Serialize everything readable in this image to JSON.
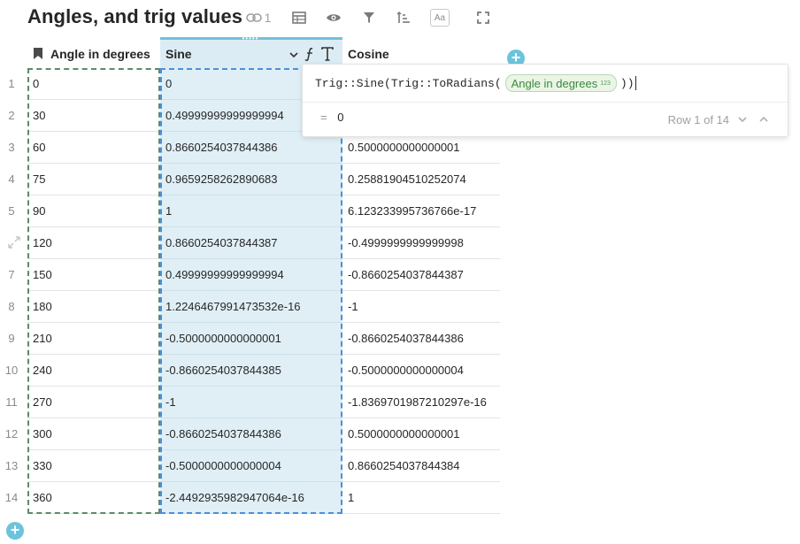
{
  "title": "Angles, and trig values",
  "toolbar": {
    "link_count": "1",
    "aa_label": "Aa"
  },
  "columns": {
    "angle": "Angle in degrees",
    "sine": "Sine",
    "cosine": "Cosine"
  },
  "rows": [
    {
      "n": "1",
      "angle": "0",
      "sine": "0",
      "cosine": ""
    },
    {
      "n": "2",
      "angle": "30",
      "sine": "0.49999999999999994",
      "cosine": ""
    },
    {
      "n": "3",
      "angle": "60",
      "sine": "0.8660254037844386",
      "cosine": "0.5000000000000001"
    },
    {
      "n": "4",
      "angle": "75",
      "sine": "0.9659258262890683",
      "cosine": "0.25881904510252074"
    },
    {
      "n": "5",
      "angle": "90",
      "sine": "1",
      "cosine": "6.123233995736766e-17"
    },
    {
      "n": "",
      "angle": "120",
      "sine": "0.8660254037844387",
      "cosine": "-0.4999999999999998"
    },
    {
      "n": "7",
      "angle": "150",
      "sine": "0.49999999999999994",
      "cosine": "-0.8660254037844387"
    },
    {
      "n": "8",
      "angle": "180",
      "sine": "1.2246467991473532e-16",
      "cosine": "-1"
    },
    {
      "n": "9",
      "angle": "210",
      "sine": "-0.5000000000000001",
      "cosine": "-0.8660254037844386"
    },
    {
      "n": "10",
      "angle": "240",
      "sine": "-0.8660254037844385",
      "cosine": "-0.5000000000000004"
    },
    {
      "n": "11",
      "angle": "270",
      "sine": "-1",
      "cosine": "-1.8369701987210297e-16"
    },
    {
      "n": "12",
      "angle": "300",
      "sine": "-0.8660254037844386",
      "cosine": "0.5000000000000001"
    },
    {
      "n": "13",
      "angle": "330",
      "sine": "-0.5000000000000004",
      "cosine": "0.8660254037844384"
    },
    {
      "n": "14",
      "angle": "360",
      "sine": "-2.4492935982947064e-16",
      "cosine": "1"
    }
  ],
  "formula": {
    "prefix": "Trig::Sine(Trig::ToRadians(",
    "chip_label": "Angle in degrees",
    "chip_type": "123",
    "suffix": "))",
    "result_eq": "=",
    "result_value": "0",
    "row_indicator": "Row 1 of 14"
  },
  "icons": {
    "link": "link-icon",
    "table": "table-icon",
    "visibility": "eye-icon",
    "filter": "filter-icon",
    "sort": "sort-icon",
    "fullscreen": "fullscreen-icon",
    "bookmark": "bookmark-icon",
    "formula": "formula-icon",
    "text_type": "text-type-icon",
    "chevron_down": "chevron-down-icon",
    "add": "add-icon",
    "expand": "expand-icon"
  }
}
